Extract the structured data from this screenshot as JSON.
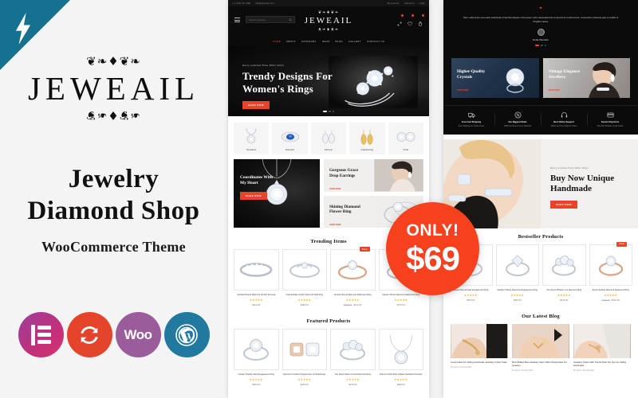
{
  "brand": {
    "name": "JEWEAIL",
    "flourish": "❦❦❦",
    "headline_line1": "Jewelry",
    "headline_line2": "Diamond Shop",
    "subhead": "WooCommerce Theme",
    "bolt_icon": "lightning-bolt-icon"
  },
  "badges": [
    {
      "key": "elementor",
      "label": "Elementor",
      "color": "#c2307a"
    },
    {
      "key": "slider",
      "label": "Slider Revolution",
      "color": "#e8442a"
    },
    {
      "key": "woo",
      "label": "Woo",
      "color": "#9a5c9a"
    },
    {
      "key": "wordpress",
      "label": "WordPress",
      "color": "#2279a0"
    }
  ],
  "site": {
    "topbar": {
      "phone": "+1 (234) 567-890",
      "email": "info@jeweail.com",
      "links": [
        "My Account",
        "Checkout",
        "Login"
      ]
    },
    "header": {
      "logo": "JEWEAIL",
      "search_placeholder": "Search products...",
      "icons": [
        "compare-icon",
        "wishlist-icon",
        "cart-icon"
      ]
    },
    "nav": [
      "HOME",
      "ABOUT",
      "CATEGORY",
      "SHOP",
      "BLOG",
      "GALLERY",
      "CONTACT US"
    ],
    "hero": {
      "eyebrow": "Hurry Limited Time Offer Only!",
      "title_line1": "Trendy Designs For",
      "title_line2": "Women's Rings",
      "cta": "SHOP NOW",
      "slide_count": 3,
      "active_slide": 1
    },
    "categories": [
      {
        "label": "Necklaces",
        "icon": "necklace-icon"
      },
      {
        "label": "Bracelets",
        "icon": "gem-ring-icon"
      },
      {
        "label": "Earrings",
        "icon": "earrings-icon"
      },
      {
        "label": "Gold Earrings",
        "icon": "gold-earrings-icon"
      },
      {
        "label": "Studs",
        "icon": "stud-earrings-icon"
      }
    ],
    "banners": {
      "main": {
        "title_line1": "Coordinates With",
        "title_line2": "My Heart",
        "cta": "SHOP NOW"
      },
      "small1": {
        "title_line1": "Gorgeous Grace",
        "title_line2": "Drop Earrings",
        "cta": "SHOP NOW"
      },
      "small2": {
        "title_line1": "Shining Diamond",
        "title_line2": "Flower Ring",
        "cta": "SHOP NOW"
      }
    },
    "trending": {
      "title": "Trending Items",
      "products": [
        {
          "name": "Certified Round Diamond Perfect Promise",
          "stars": "★★★★★",
          "price": "$420.00",
          "old_price": "",
          "badge": ""
        },
        {
          "name": "Oval Solitaire Gothic Diamond Split Ring",
          "stars": "★★★★★",
          "price": "$380.00",
          "old_price": "",
          "badge": ""
        },
        {
          "name": "Sunrise Round Diamond Statement Ring",
          "stars": "★★★★★",
          "price": "$310.00",
          "old_price": "$365.00",
          "badge": "SALE"
        },
        {
          "name": "Classic Vibrant Diamond Statement Ring",
          "stars": "★★★★★",
          "price": "$475.00",
          "old_price": "",
          "badge": ""
        }
      ]
    },
    "featured": {
      "title": "Featured Products",
      "products": [
        {
          "name": "Classic Twinkle Halo Engagement Ring",
          "stars": "★★★★★",
          "price": "$520.00",
          "old_price": "",
          "badge": ""
        },
        {
          "name": "Diamond Cushion Shaped Gem Stud Earrings",
          "stars": "★★★★★",
          "price": "$265.00",
          "old_price": "",
          "badge": ""
        },
        {
          "name": "Trio Stone Wave Curved Diamond Ring",
          "stars": "★★★★★",
          "price": "$410.00",
          "old_price": "",
          "badge": ""
        },
        {
          "name": "Diamond Pamphlet Classic Necklace Pendant",
          "stars": "★★★★★",
          "price": "$395.00",
          "old_price": "",
          "badge": ""
        }
      ]
    },
    "testimonial": {
      "quote": "Nam nulla turpis venenatis sollicitudin imperdiet aliquam duis quam velit malesuada felis temporal at condimentum consectetur placerat quis convallis ut fringilla massa.",
      "author": "Sofia Danielle",
      "dot_count": 3
    },
    "two_banners": [
      {
        "title_line1": "Higher-Quality",
        "title_line2": "Crystals",
        "cta": "SHOP NOW"
      },
      {
        "title_line1": "Vintage Elegance",
        "title_line2": "Jewellery",
        "cta": "SHOP NOW"
      }
    ],
    "features": [
      {
        "icon": "truck-icon",
        "title": "Free Fast Shipping",
        "subtitle": "Free Shipping On Orders Over"
      },
      {
        "icon": "tag-icon",
        "title": "Our Biggest Deals",
        "subtitle": "Within an Best Forever Refunds"
      },
      {
        "icon": "headset-icon",
        "title": "Best Online Support",
        "subtitle": "Within an Hour Support Online"
      },
      {
        "icon": "card-icon",
        "title": "Secure Payments",
        "subtitle": "Pay With Multiple Credit Cards"
      }
    ],
    "promo": {
      "eyebrow": "Hurry Limited Time Offer Only!",
      "title_line1": "Buy Now Unique",
      "title_line2": "Handmade",
      "cta": "SHOP NOW"
    },
    "bestseller": {
      "title": "Bestseller Products",
      "products": [
        {
          "name": "Classic Round Halo Engagement Ring",
          "stars": "★★★★★",
          "price": "$455.00",
          "old_price": "",
          "badge": ""
        },
        {
          "name": "Radiant Tribute Diamond Engagement Ring",
          "stars": "★★★★★",
          "price": "$390.00",
          "old_price": "",
          "badge": ""
        },
        {
          "name": "Trio Stone Whisper Cut Diamond Ring",
          "stars": "★★★★★",
          "price": "$425.00",
          "old_price": "",
          "badge": ""
        },
        {
          "name": "Exotic Swirled Diamond Statement Ring",
          "stars": "★★★★★",
          "price": "$340.00",
          "old_price": "$399.00",
          "badge": "SALE"
        }
      ]
    },
    "blog": {
      "title": "Our Latest Blog",
      "posts": [
        {
          "title": "Lovely Ideas For Selling Handmade Jewellery Online Trade",
          "meta": "By Admin | 24 April 2024"
        },
        {
          "title": "Most Brilliant Best Jewellery Store Offers Responsible For Question",
          "meta": "By Admin | 18 April 2024"
        },
        {
          "title": "Jewellery Online With Trends What Top Tips For Selling Handmade",
          "meta": "By Admin | 09 April 2024"
        }
      ]
    }
  },
  "price_badge": {
    "label": "ONLY!",
    "amount": "$69",
    "color": "#f5411d"
  }
}
